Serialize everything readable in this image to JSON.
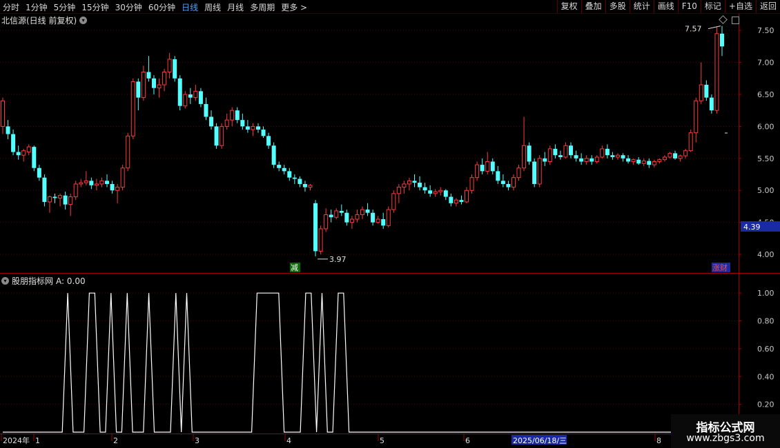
{
  "toolbar": {
    "periods": [
      "分时",
      "1分钟",
      "5分钟",
      "15分钟",
      "30分钟",
      "60分钟",
      "日线",
      "周线",
      "月线",
      "多周期",
      "更多 >"
    ],
    "active_period": "日线",
    "actions": [
      "复权",
      "叠加",
      "多股",
      "统计",
      "画线",
      "F10",
      "标记",
      "+自选",
      "返回"
    ]
  },
  "header": {
    "stock_title": "北信源(日线 前复权)",
    "indicator_title": "股朋指标网",
    "indicator_value": "A: 0.00"
  },
  "colors": {
    "up": "#ff3b3b",
    "down": "#54ffff",
    "grid": "#5a0000",
    "axis_text": "#c8c8c8",
    "date_highlight": "#1a2aa0",
    "indicator_line": "#ffffff"
  },
  "watermark": {
    "line1": "指标公式网",
    "line2": "www.zbgs3.com"
  },
  "chart_data": [
    {
      "type": "candlestick",
      "title": "北信源(日线 前复权)",
      "ylim": [
        3.85,
        7.62
      ],
      "yticks": [
        "7.50",
        "7.00",
        "6.50",
        "6.00",
        "5.50",
        "5.00",
        "4.50",
        "4.00"
      ],
      "current_price_label": "4.39",
      "high_annotation": "7.57",
      "low_annotation": "3.97",
      "markers": [
        {
          "text": "减",
          "at": "low"
        },
        {
          "text": "涨财",
          "at": "right"
        }
      ],
      "ohlc": [
        [
          6.0,
          6.45,
          5.88,
          6.4
        ],
        [
          6.0,
          6.1,
          5.8,
          5.88
        ],
        [
          5.88,
          5.95,
          5.55,
          5.6
        ],
        [
          5.6,
          5.7,
          5.48,
          5.55
        ],
        [
          5.55,
          5.65,
          5.45,
          5.62
        ],
        [
          5.6,
          5.72,
          5.55,
          5.68
        ],
        [
          5.68,
          5.7,
          5.3,
          5.35
        ],
        [
          5.35,
          5.4,
          5.15,
          5.2
        ],
        [
          5.2,
          5.25,
          4.75,
          4.82
        ],
        [
          4.82,
          4.92,
          4.65,
          4.9
        ],
        [
          4.9,
          4.95,
          4.8,
          4.88
        ],
        [
          4.88,
          4.95,
          4.75,
          4.92
        ],
        [
          4.92,
          4.98,
          4.7,
          4.78
        ],
        [
          4.78,
          4.95,
          4.6,
          4.9
        ],
        [
          4.9,
          5.15,
          4.85,
          5.1
        ],
        [
          5.1,
          5.18,
          5.05,
          5.12
        ],
        [
          5.12,
          5.3,
          5.08,
          5.15
        ],
        [
          5.15,
          5.2,
          5.02,
          5.08
        ],
        [
          5.08,
          5.18,
          5.0,
          5.1
        ],
        [
          5.1,
          5.2,
          5.05,
          5.15
        ],
        [
          5.15,
          5.25,
          5.05,
          5.1
        ],
        [
          5.1,
          5.15,
          4.95,
          5.0
        ],
        [
          5.0,
          5.1,
          4.8,
          5.05
        ],
        [
          5.05,
          5.4,
          5.0,
          5.35
        ],
        [
          5.35,
          5.9,
          5.3,
          5.85
        ],
        [
          5.85,
          6.75,
          5.8,
          6.7
        ],
        [
          6.7,
          6.75,
          6.25,
          6.45
        ],
        [
          6.45,
          6.95,
          6.4,
          6.85
        ],
        [
          6.85,
          7.1,
          6.7,
          6.75
        ],
        [
          6.75,
          6.8,
          6.5,
          6.6
        ],
        [
          6.6,
          6.75,
          6.45,
          6.65
        ],
        [
          6.65,
          6.9,
          6.55,
          6.85
        ],
        [
          6.85,
          7.15,
          6.75,
          7.05
        ],
        [
          7.05,
          7.1,
          6.7,
          6.75
        ],
        [
          6.75,
          6.8,
          6.25,
          6.32
        ],
        [
          6.32,
          6.55,
          6.28,
          6.5
        ],
        [
          6.5,
          6.6,
          6.35,
          6.45
        ],
        [
          6.45,
          6.65,
          6.4,
          6.55
        ],
        [
          6.55,
          6.6,
          6.3,
          6.35
        ],
        [
          6.35,
          6.45,
          6.1,
          6.15
        ],
        [
          6.15,
          6.25,
          5.95,
          6.0
        ],
        [
          6.0,
          6.05,
          5.65,
          5.7
        ],
        [
          5.7,
          6.05,
          5.65,
          6.0
        ],
        [
          6.0,
          6.2,
          5.95,
          6.1
        ],
        [
          6.1,
          6.3,
          6.0,
          6.25
        ],
        [
          6.25,
          6.3,
          6.05,
          6.1
        ],
        [
          6.1,
          6.2,
          5.95,
          6.0
        ],
        [
          6.0,
          6.1,
          5.9,
          5.95
        ],
        [
          5.95,
          6.05,
          5.85,
          6.0
        ],
        [
          6.0,
          6.05,
          5.9,
          5.95
        ],
        [
          5.95,
          6.0,
          5.82,
          5.85
        ],
        [
          5.85,
          5.9,
          5.65,
          5.7
        ],
        [
          5.7,
          5.75,
          5.35,
          5.4
        ],
        [
          5.4,
          5.45,
          5.3,
          5.35
        ],
        [
          5.35,
          5.4,
          5.25,
          5.3
        ],
        [
          5.3,
          5.35,
          5.15,
          5.2
        ],
        [
          5.2,
          5.25,
          5.1,
          5.18
        ],
        [
          5.18,
          5.22,
          5.05,
          5.1
        ],
        [
          5.1,
          5.15,
          4.98,
          5.05
        ],
        [
          5.05,
          5.1,
          5.0,
          5.08
        ],
        [
          4.8,
          4.85,
          3.97,
          4.05
        ],
        [
          4.05,
          4.45,
          4.0,
          4.4
        ],
        [
          4.4,
          4.72,
          4.35,
          4.62
        ],
        [
          4.62,
          4.7,
          4.5,
          4.58
        ],
        [
          4.58,
          4.72,
          4.55,
          4.68
        ],
        [
          4.68,
          4.78,
          4.6,
          4.65
        ],
        [
          4.65,
          4.7,
          4.45,
          4.5
        ],
        [
          4.5,
          4.6,
          4.4,
          4.55
        ],
        [
          4.55,
          4.7,
          4.5,
          4.62
        ],
        [
          4.62,
          4.75,
          4.55,
          4.7
        ],
        [
          4.7,
          4.8,
          4.6,
          4.65
        ],
        [
          4.65,
          4.7,
          4.45,
          4.5
        ],
        [
          4.5,
          4.6,
          4.48,
          4.55
        ],
        [
          4.55,
          4.65,
          4.4,
          4.45
        ],
        [
          4.45,
          4.75,
          4.42,
          4.7
        ],
        [
          4.7,
          5.0,
          4.65,
          4.95
        ],
        [
          4.95,
          5.1,
          4.8,
          5.05
        ],
        [
          5.05,
          5.15,
          4.95,
          5.1
        ],
        [
          5.1,
          5.2,
          5.0,
          5.15
        ],
        [
          5.15,
          5.25,
          5.05,
          5.12
        ],
        [
          5.12,
          5.22,
          5.0,
          5.05
        ],
        [
          5.05,
          5.12,
          4.95,
          5.0
        ],
        [
          5.0,
          5.08,
          4.9,
          4.95
        ],
        [
          4.95,
          5.02,
          4.9,
          4.98
        ],
        [
          4.98,
          5.05,
          4.92,
          5.0
        ],
        [
          5.0,
          5.02,
          4.85,
          4.9
        ],
        [
          4.9,
          4.95,
          4.75,
          4.8
        ],
        [
          4.8,
          4.88,
          4.75,
          4.85
        ],
        [
          4.85,
          4.92,
          4.78,
          4.82
        ],
        [
          4.82,
          5.05,
          4.8,
          5.0
        ],
        [
          5.0,
          5.25,
          4.95,
          5.2
        ],
        [
          5.2,
          5.45,
          5.15,
          5.4
        ],
        [
          5.4,
          5.5,
          5.25,
          5.3
        ],
        [
          5.3,
          5.6,
          5.25,
          5.45
        ],
        [
          5.45,
          5.5,
          5.25,
          5.3
        ],
        [
          5.3,
          5.38,
          5.1,
          5.15
        ],
        [
          5.15,
          5.25,
          5.05,
          5.1
        ],
        [
          5.1,
          5.15,
          5.0,
          5.05
        ],
        [
          5.05,
          5.25,
          5.0,
          5.2
        ],
        [
          5.2,
          5.4,
          5.15,
          5.35
        ],
        [
          5.35,
          6.15,
          5.3,
          5.7
        ],
        [
          5.7,
          5.75,
          5.4,
          5.45
        ],
        [
          5.45,
          5.5,
          5.05,
          5.1
        ],
        [
          5.1,
          5.55,
          5.05,
          5.5
        ],
        [
          5.5,
          5.6,
          5.38,
          5.45
        ],
        [
          5.45,
          5.7,
          5.4,
          5.65
        ],
        [
          5.65,
          5.72,
          5.5,
          5.55
        ],
        [
          5.55,
          5.62,
          5.48,
          5.52
        ],
        [
          5.52,
          5.75,
          5.5,
          5.7
        ],
        [
          5.7,
          5.75,
          5.5,
          5.55
        ],
        [
          5.55,
          5.62,
          5.45,
          5.5
        ],
        [
          5.5,
          5.58,
          5.4,
          5.45
        ],
        [
          5.45,
          5.55,
          5.4,
          5.5
        ],
        [
          5.5,
          5.55,
          5.4,
          5.45
        ],
        [
          5.45,
          5.55,
          5.42,
          5.52
        ],
        [
          5.52,
          5.7,
          5.5,
          5.65
        ],
        [
          5.65,
          5.72,
          5.5,
          5.55
        ],
        [
          5.55,
          5.6,
          5.48,
          5.52
        ],
        [
          5.52,
          5.58,
          5.48,
          5.55
        ],
        [
          5.55,
          5.58,
          5.45,
          5.5
        ],
        [
          5.5,
          5.55,
          5.42,
          5.45
        ],
        [
          5.45,
          5.5,
          5.4,
          5.48
        ],
        [
          5.48,
          5.52,
          5.4,
          5.42
        ],
        [
          5.42,
          5.5,
          5.38,
          5.46
        ],
        [
          5.46,
          5.5,
          5.35,
          5.4
        ],
        [
          5.4,
          5.48,
          5.36,
          5.45
        ],
        [
          5.45,
          5.5,
          5.42,
          5.48
        ],
        [
          5.48,
          5.55,
          5.45,
          5.52
        ],
        [
          5.52,
          5.6,
          5.5,
          5.58
        ],
        [
          5.58,
          5.62,
          5.48,
          5.5
        ],
        [
          5.5,
          5.56,
          5.45,
          5.54
        ],
        [
          5.54,
          5.65,
          5.5,
          5.62
        ],
        [
          5.62,
          5.95,
          5.6,
          5.9
        ],
        [
          5.9,
          6.45,
          5.75,
          6.4
        ],
        [
          6.4,
          7.0,
          6.35,
          6.65
        ],
        [
          6.65,
          6.72,
          6.4,
          6.45
        ],
        [
          6.45,
          6.5,
          6.2,
          6.25
        ],
        [
          6.25,
          7.55,
          6.2,
          7.45
        ],
        [
          7.45,
          7.57,
          7.1,
          7.25
        ]
      ]
    },
    {
      "type": "line",
      "title": "股朋指标网",
      "ylim": [
        0,
        1.1
      ],
      "yticks": [
        "1.00",
        "0.80",
        "0.60",
        "0.40",
        "0.20"
      ],
      "series": [
        {
          "name": "A",
          "values": [
            0,
            0,
            0,
            0,
            0,
            0,
            0,
            0,
            0,
            0,
            0,
            0,
            1,
            0,
            0,
            0,
            1,
            1,
            0,
            0,
            1,
            0,
            0,
            1,
            0,
            0,
            0,
            1,
            0,
            0,
            0,
            0,
            1,
            0,
            1,
            0,
            0,
            0,
            0,
            0,
            0,
            0,
            0,
            0,
            0,
            0,
            0,
            1,
            1,
            1,
            1,
            1,
            0,
            0,
            0,
            0,
            1,
            1,
            0,
            1,
            0,
            0,
            1,
            1,
            0,
            0,
            0,
            0,
            0,
            0,
            0,
            0,
            0,
            0,
            0,
            0,
            0,
            0,
            0,
            0,
            0,
            0,
            0,
            0,
            0,
            0,
            0,
            0,
            0,
            0,
            0,
            0,
            0,
            0,
            0,
            0,
            0,
            0,
            0,
            0,
            0,
            0,
            0,
            0,
            0,
            0,
            0,
            0,
            0,
            0,
            0,
            0,
            0,
            0,
            0,
            0,
            0,
            0,
            0,
            0,
            0,
            0,
            0,
            0,
            0,
            0,
            0,
            0,
            0,
            0,
            0,
            0,
            0,
            0,
            0,
            0,
            0
          ]
        }
      ]
    },
    {
      "type": "date_axis",
      "labels": [
        "2024年",
        "1",
        "2",
        "3",
        "4",
        "5",
        "6",
        "8"
      ],
      "highlight": "2025/06/18/三"
    }
  ]
}
